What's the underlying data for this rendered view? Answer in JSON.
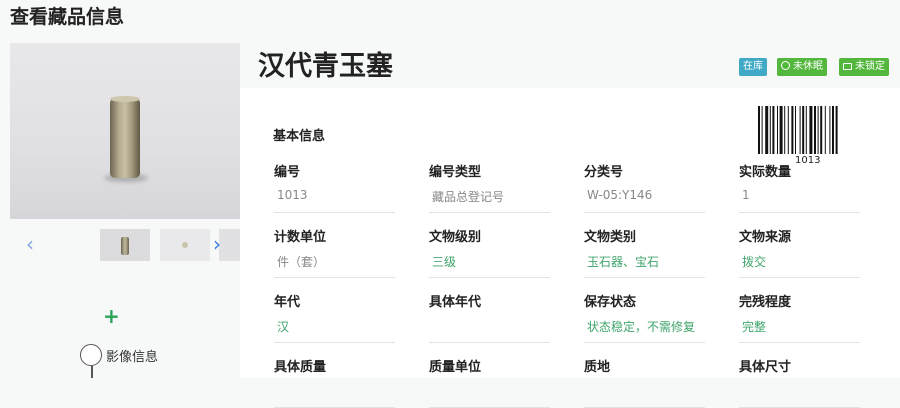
{
  "page": {
    "title": "查看藏品信息"
  },
  "gallery": {
    "add_label": "+",
    "image_info_label": "影像信息"
  },
  "item": {
    "name": "汉代青玉塞",
    "badges": [
      "在库",
      "未休眠",
      "未锁定"
    ],
    "barcode_number": "1013"
  },
  "section": {
    "title": "基本信息"
  },
  "fields": [
    [
      {
        "label": "编号",
        "value": "1013",
        "style": "plain"
      },
      {
        "label": "编号类型",
        "value": "藏品总登记号",
        "style": "plain"
      },
      {
        "label": "分类号",
        "value": "W-05:Y146",
        "style": "plain"
      },
      {
        "label": "实际数量",
        "value": "1",
        "style": "plain"
      }
    ],
    [
      {
        "label": "计数单位",
        "value": "件（套）",
        "style": "plain"
      },
      {
        "label": "文物级别",
        "value": "三级",
        "style": "link"
      },
      {
        "label": "文物类别",
        "value": "玉石器、宝石",
        "style": "link"
      },
      {
        "label": "文物来源",
        "value": "拨交",
        "style": "link"
      }
    ],
    [
      {
        "label": "年代",
        "value": "汉",
        "style": "link"
      },
      {
        "label": "具体年代",
        "value": "",
        "style": "plain"
      },
      {
        "label": "保存状态",
        "value": "状态稳定，不需修复",
        "style": "link"
      },
      {
        "label": "完残程度",
        "value": "完整",
        "style": "link"
      }
    ],
    [
      {
        "label": "具体质量",
        "value": "",
        "style": "plain"
      },
      {
        "label": "质量单位",
        "value": "",
        "style": "plain"
      },
      {
        "label": "质地",
        "value": "",
        "style": "plain"
      },
      {
        "label": "具体尺寸",
        "value": "",
        "style": "plain"
      }
    ]
  ],
  "colors": {
    "accent_green": "#52b73c",
    "badge_blue": "#3fa9c6",
    "link_green": "#3fa56b"
  }
}
